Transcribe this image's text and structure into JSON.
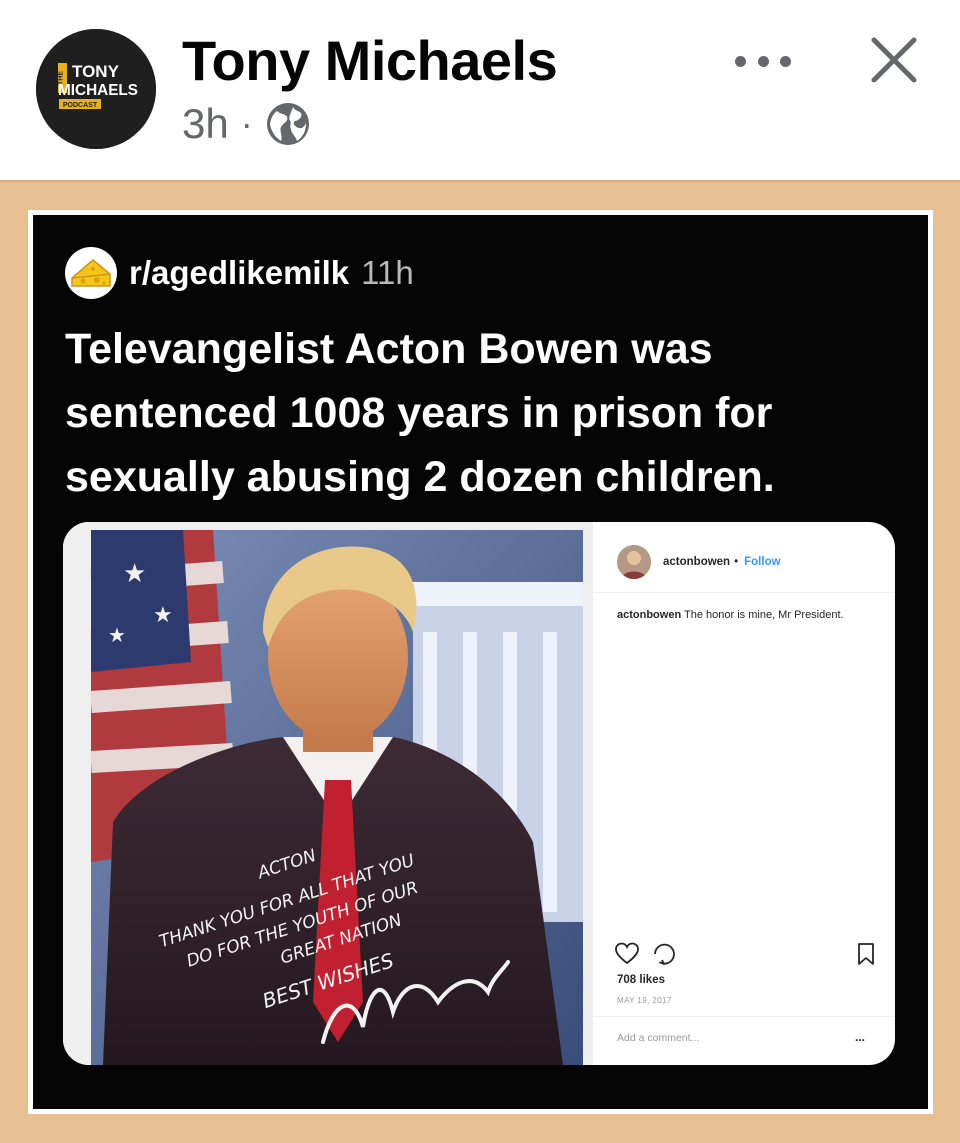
{
  "post": {
    "author": "Tony Michaels",
    "time": "3h",
    "separator": "·",
    "avatar_text": {
      "line1": "TONY",
      "line2": "MICHAELS",
      "prefix": "THE",
      "badge": "PODCAST"
    },
    "icons": {
      "privacy": "globe-icon",
      "more": "more-horizontal-icon",
      "close": "close-icon"
    }
  },
  "reddit": {
    "subreddit": "r/agedlikemilk",
    "time": "11h",
    "headline": "Televangelist Acton Bowen was sentenced 1008 years in prison for sexually abusing 2 dozen children.",
    "icon": "cheese-icon"
  },
  "instagram": {
    "username": "actonbowen",
    "separator": "•",
    "follow": "Follow",
    "caption_user": "actonbowen",
    "caption_text": "The honor is mine, Mr President.",
    "likes": "708 likes",
    "date": "MAY 19, 2017",
    "comment_placeholder": "Add a comment...",
    "more": "...",
    "photo_inscription": {
      "line1": "ACTON",
      "line2": "THANK YOU FOR ALL THAT YOU",
      "line3": "DO FOR THE YOUTH OF OUR",
      "line4": "GREAT NATION",
      "line5": "BEST WISHES"
    }
  },
  "colors": {
    "media_bg": "#e6bf93",
    "screen_bg": "#050505",
    "meta_gray": "#65676b",
    "ig_link": "#3897f0"
  }
}
